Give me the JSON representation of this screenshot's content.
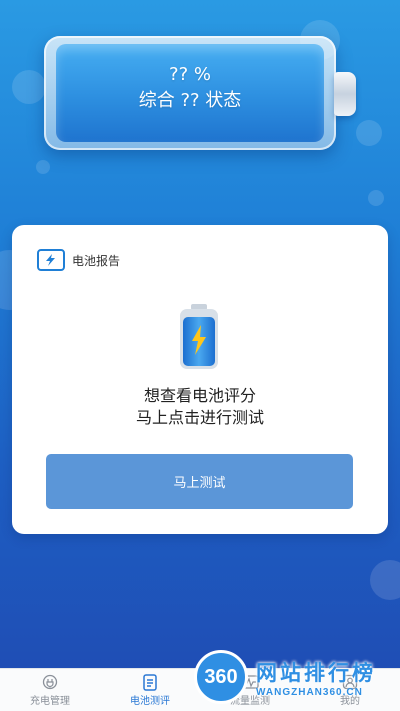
{
  "battery": {
    "percent_text": "?? %",
    "status_text": "综合 ?? 状态"
  },
  "report": {
    "title": "电池报告",
    "message_line1": "想查看电池评分",
    "message_line2": "马上点击进行测试",
    "button_label": "马上测试"
  },
  "tabs": [
    {
      "label": "充电管理",
      "icon": "plug-icon",
      "active": false
    },
    {
      "label": "电池测评",
      "icon": "clipboard-icon",
      "active": true
    },
    {
      "label": "流量监测",
      "icon": "pulse-icon",
      "active": false
    },
    {
      "label": "我的",
      "icon": "user-icon",
      "active": false
    }
  ],
  "watermark": {
    "circle_text": "360",
    "title": "网站排行榜",
    "subtitle": "WANGZHAN360.CN"
  },
  "colors": {
    "primary": "#1f7fd6",
    "button": "#5b96d8",
    "tab_active": "#2a78d4"
  }
}
